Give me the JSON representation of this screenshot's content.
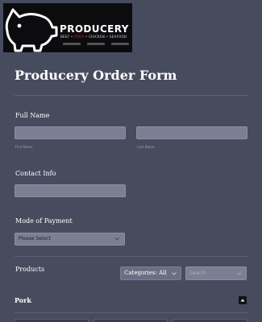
{
  "brand": {
    "name": "PRODUCERY",
    "tagline_parts": [
      "BEEF • ",
      "PORK",
      " • CHICKEN • SEAFOOD"
    ],
    "accent_color": "#c8202a",
    "logo_icon": "pig-icon"
  },
  "form": {
    "title": "Producery Order Form",
    "full_name": {
      "label": "Full Name",
      "first_sublabel": "First Name",
      "last_sublabel": "Last Name",
      "first_value": "",
      "last_value": ""
    },
    "contact": {
      "label": "Contact Info",
      "value": ""
    },
    "payment": {
      "label": "Mode of Payment",
      "selected": "Please Select"
    },
    "products": {
      "label": "Products",
      "category_selected": "Categories: All",
      "search_placeholder": "Search",
      "groups": [
        {
          "name": "Pork",
          "expanded": true
        }
      ]
    }
  }
}
